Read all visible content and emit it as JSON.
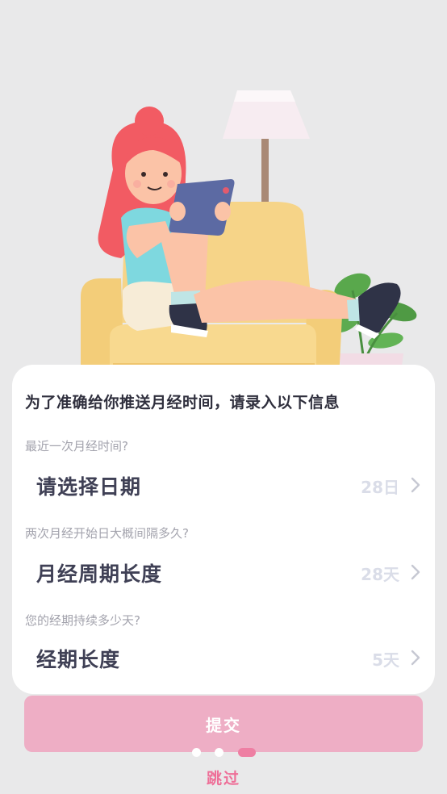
{
  "card": {
    "title": "为了准确给你推送月经时间，请录入以下信息",
    "questions": [
      {
        "label": "最近一次月经时间?",
        "main": "请选择日期",
        "value": "28日"
      },
      {
        "label": "两次月经开始日大概间隔多久?",
        "main": "月经周期长度",
        "value": "28天"
      },
      {
        "label": "您的经期持续多少天?",
        "main": "经期长度",
        "value": "5天"
      }
    ]
  },
  "actions": {
    "submit": "提交",
    "skip": "跳过"
  },
  "pager": {
    "total": 3,
    "active": 3
  },
  "colors": {
    "background": "#e9e9ea",
    "accent": "#ee7fa3",
    "submit_bg": "#eeaec5",
    "skip_text": "#ee6f98"
  },
  "illustration": {
    "icon": "girl-on-sofa-illustration"
  }
}
